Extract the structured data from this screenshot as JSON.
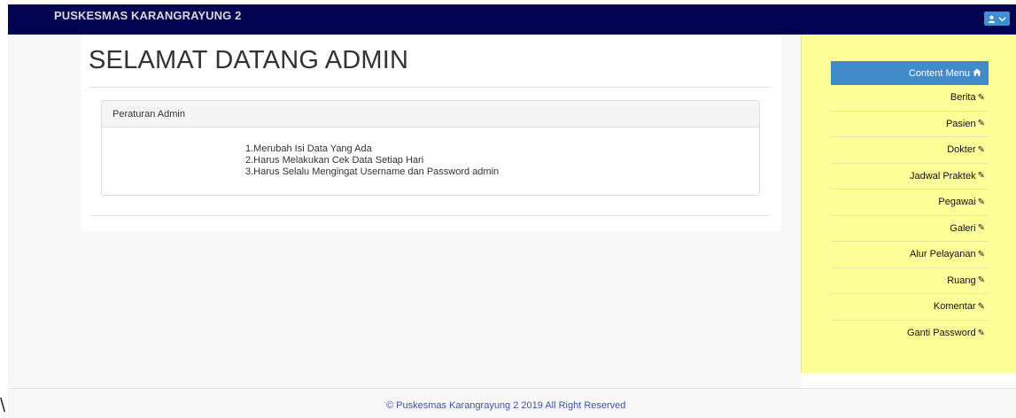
{
  "header": {
    "brand": "PUSKESMAS KARANGRAYUNG 2"
  },
  "main": {
    "title": "SELAMAT DATANG ADMIN",
    "rules_panel": {
      "heading": "Peraturan Admin",
      "items": [
        "1.Merubah Isi Data Yang Ada",
        "2.Harus Melakukan Cek Data Setiap Hari",
        "3.Harus Selalu Mengingat Username dan Password admin"
      ]
    }
  },
  "sidebar": {
    "heading": "Content Menu",
    "heading_icon": "home-icon",
    "items": [
      {
        "label": "Berita ",
        "icon": "pencil-icon"
      },
      {
        "label": "Pasien ",
        "icon": "pencil-icon"
      },
      {
        "label": "Dokter",
        "icon": "pencil-icon"
      },
      {
        "label": "Jadwal Praktek ",
        "icon": "pencil-icon"
      },
      {
        "label": "Pegawai ",
        "icon": "pencil-icon"
      },
      {
        "label": "Galeri ",
        "icon": "pencil-icon"
      },
      {
        "label": "Alur Pelayanan",
        "icon": "pencil-icon"
      },
      {
        "label": "Ruang",
        "icon": "pencil-icon"
      },
      {
        "label": "Komentar",
        "icon": "pencil-icon"
      },
      {
        "label": "Ganti Password",
        "icon": "pencil-icon"
      }
    ]
  },
  "footer": {
    "text": "© Puskesmas Karangrayung 2 2019 All Right Reserved"
  },
  "colors": {
    "navbar": "#020350",
    "sidebar": "#ffff99",
    "sidebar_heading": "#428bca",
    "footer_text": "#3a53a4"
  }
}
